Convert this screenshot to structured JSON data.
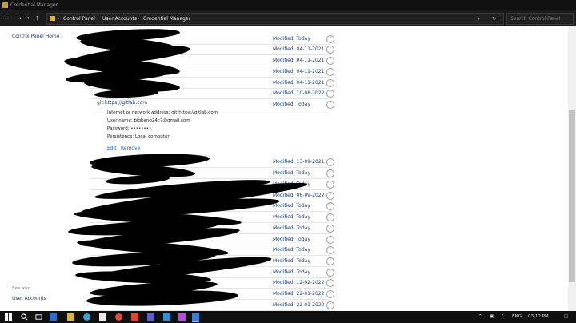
{
  "window": {
    "title": "Credential Manager"
  },
  "address": {
    "crumbs": [
      "Control Panel",
      "User Accounts",
      "Credential Manager"
    ],
    "search_placeholder": "Search Control Panel"
  },
  "sidebar": {
    "home": "Control Panel Home",
    "see_also": "See also",
    "user_accounts": "User Accounts"
  },
  "credential": {
    "name": "git:https://gitlab.com",
    "details": [
      "Internet or network address:  git:https://gitlab.com",
      "User name:  bigbang24c7@gmail.com",
      "Password:  ••••••••",
      "Persistence:  Local computer"
    ],
    "edit": "Edit",
    "remove": "Remove"
  },
  "rows_top": [
    "Modified:  Today",
    "Modified:  04-11-2021",
    "Modified:  04-11-2021",
    "Modified:  04-11-2021",
    "Modified:  04-11-2021",
    "Modified:  10-08-2022",
    "Modified:  Today"
  ],
  "rows_bottom": [
    "Modified:  13-09-2021",
    "Modified:  Today",
    "Modified:  Today",
    "Modified:  06-09-2022",
    "Modified:  Today",
    "Modified:  Today",
    "Modified:  Today",
    "Modified:  Today",
    "Modified:  Today",
    "Modified:  Today",
    "Modified:  Today",
    "Modified:  12-02-2022",
    "Modified:  22-01-2022",
    "Modified:  22-01-2022"
  ],
  "taskbar": {
    "lang": "ENG",
    "time": "03:12 PM"
  }
}
